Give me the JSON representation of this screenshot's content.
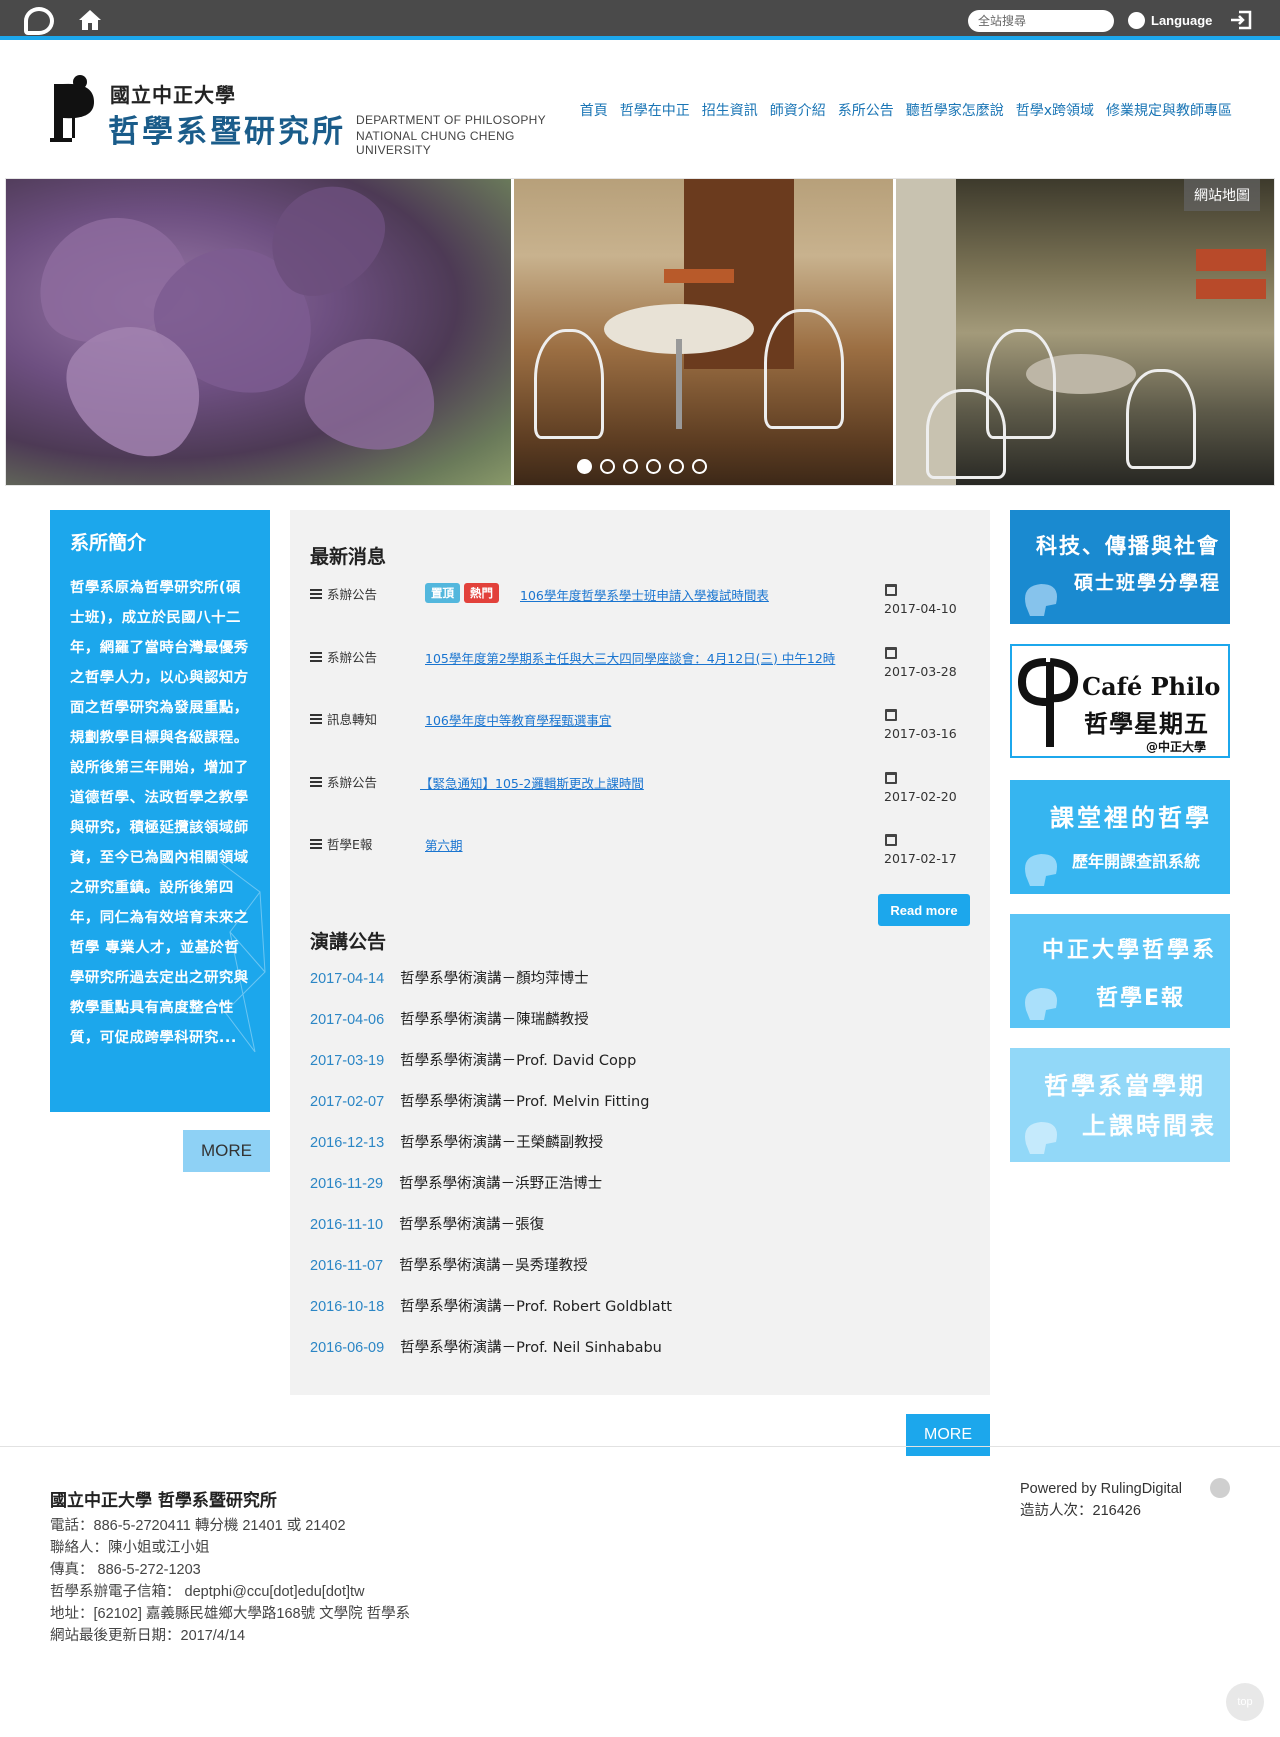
{
  "topbar": {
    "search_placeholder": "全站搜尋",
    "language_label": "Language"
  },
  "header": {
    "university": "國立中正大學",
    "department": "哲學系暨研究所",
    "english_line1": "DEPARTMENT OF PHILOSOPHY",
    "english_line2": "NATIONAL CHUNG CHENG UNIVERSITY"
  },
  "nav": {
    "items": [
      "首頁",
      "哲學在中正",
      "招生資訊",
      "師資介紹",
      "系所公告",
      "聽哲學家怎麼說",
      "哲學x跨領域",
      "修業規定與教師專區"
    ]
  },
  "banner": {
    "sitemap_label": "網站地圖",
    "slide_count": 6,
    "active_slide": 1
  },
  "intro": {
    "title": "系所簡介",
    "text": "哲學系原為哲學研究所(碩士班)，成立於民國八十二年，網羅了當時台灣最優秀之哲學人力，以心與認知方面之哲學研究為發展重點，規劃教學目標與各級課程。設所後第三年開始，增加了道德哲學、法政哲學之教學與研究，積極延攬該領域師資，至今已為國內相關領域之研究重鎮。設所後第四年，同仁為有效培育未來之哲學 專業人才，並基於哲學研究所過去定出之研究與教學重點具有高度整合性質，可促成跨學科研究...",
    "more_label": "MORE"
  },
  "news": {
    "title": "最新消息",
    "items": [
      {
        "category": "系辦公告",
        "tags": [
          "置頂",
          "熱門"
        ],
        "title": "106學年度哲學系學士班申請入學複試時間表",
        "date": "2017-04-10"
      },
      {
        "category": "系辦公告",
        "tags": [],
        "title": "105學年度第2學期系主任與大三大四同學座談會：4月12日(三) 中午12時",
        "date": "2017-03-28"
      },
      {
        "category": "訊息轉知",
        "tags": [],
        "title": "106學年度中等教育學程甄選事宜",
        "date": "2017-03-16"
      },
      {
        "category": "系辦公告",
        "tags": [],
        "title": "【緊急通知】105-2邏輯斯更改上課時間",
        "date": "2017-02-20"
      },
      {
        "category": "哲學E報",
        "tags": [],
        "title": "第六期",
        "date": "2017-02-17"
      }
    ],
    "read_more_label": "Read more"
  },
  "lectures": {
    "title": "演講公告",
    "items": [
      {
        "date": "2017-04-14",
        "title": "哲學系學術演講－顏均萍博士"
      },
      {
        "date": "2017-04-06",
        "title": "哲學系學術演講－陳瑞麟教授"
      },
      {
        "date": "2017-03-19",
        "title": "哲學系學術演講－Prof. David Copp"
      },
      {
        "date": "2017-02-07",
        "title": "哲學系學術演講－Prof. Melvin Fitting"
      },
      {
        "date": "2016-12-13",
        "title": "哲學系學術演講－王榮麟副教授"
      },
      {
        "date": "2016-11-29",
        "title": "哲學系學術演講－浜野正浩博士"
      },
      {
        "date": "2016-11-10",
        "title": "哲學系學術演講－張復"
      },
      {
        "date": "2016-11-07",
        "title": "哲學系學術演講－吳秀瑾教授"
      },
      {
        "date": "2016-10-18",
        "title": "哲學系學術演講－Prof. Robert Goldblatt"
      },
      {
        "date": "2016-06-09",
        "title": "哲學系學術演講－Prof. Neil Sinhababu"
      }
    ],
    "more_label": "MORE"
  },
  "side_banners": [
    {
      "line1": "科技、傳播與社會",
      "line2": "碩士班學分學程"
    },
    {
      "line1": "Café Philo",
      "line2": "哲學星期五",
      "line3": "@中正大學"
    },
    {
      "line1": "課堂裡的哲學",
      "line2": "歷年開課查訊系統"
    },
    {
      "line1": "中正大學哲學系",
      "line2": "哲學E報"
    },
    {
      "line1": "哲學系當學期",
      "line2": "上課時間表"
    }
  ],
  "footer": {
    "title": "國立中正大學 哲學系暨研究所",
    "lines": [
      "電話：886-5-2720411 轉分機 21401 或  21402",
      "聯絡人：陳小姐或江小姐",
      "傳真： 886-5-272-1203",
      "哲學系辦電子信箱： deptphi@ccu[dot]edu[dot]tw",
      "地址：[62102] 嘉義縣民雄鄉大學路168號 文學院 哲學系",
      "網站最後更新日期：2017/4/14"
    ],
    "powered_by": "Powered by RulingDigital",
    "visitors": "造訪人次：216426",
    "top_label": "top"
  },
  "colors": {
    "accent": "#1ca7ec",
    "topbar": "#4a4a4a",
    "link": "#1a75d0",
    "hot": "#e2413b",
    "pinned": "#53b7dd"
  }
}
